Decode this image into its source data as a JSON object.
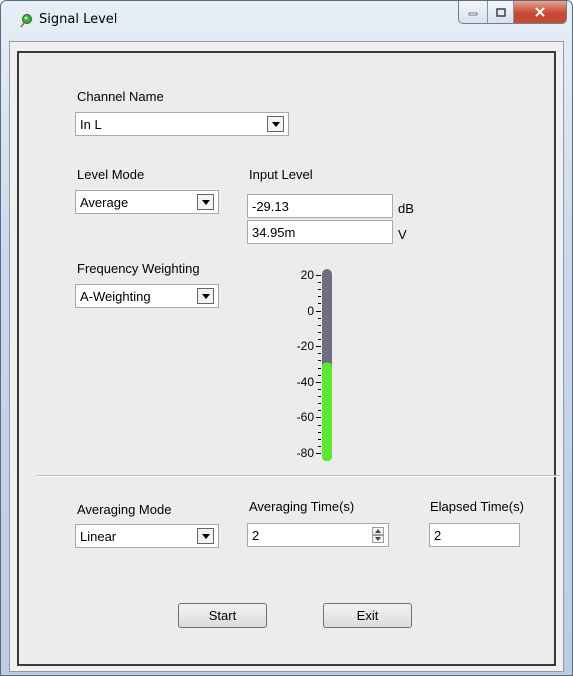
{
  "window": {
    "title": "Signal Level"
  },
  "channel": {
    "label": "Channel Name",
    "value": "In L"
  },
  "level_mode": {
    "label": "Level Mode",
    "value": "Average"
  },
  "input_level": {
    "label": "Input Level",
    "db_value": "-29.13",
    "db_unit": "dB",
    "v_value": "34.95m",
    "v_unit": "V"
  },
  "freq_weighting": {
    "label": "Frequency Weighting",
    "value": "A-Weighting"
  },
  "meter": {
    "ticks": [
      "20",
      "0",
      "-20",
      "-40",
      "-60",
      "-80"
    ],
    "max": 20,
    "min": -80,
    "level": -29.13,
    "fill_color": "#5ee832",
    "track_color": "#6f6e80"
  },
  "averaging_mode": {
    "label": "Averaging Mode",
    "value": "Linear"
  },
  "averaging_time": {
    "label": "Averaging Time(s)",
    "value": "2"
  },
  "elapsed_time": {
    "label": "Elapsed Time(s)",
    "value": "2"
  },
  "buttons": {
    "start": "Start",
    "exit": "Exit"
  }
}
